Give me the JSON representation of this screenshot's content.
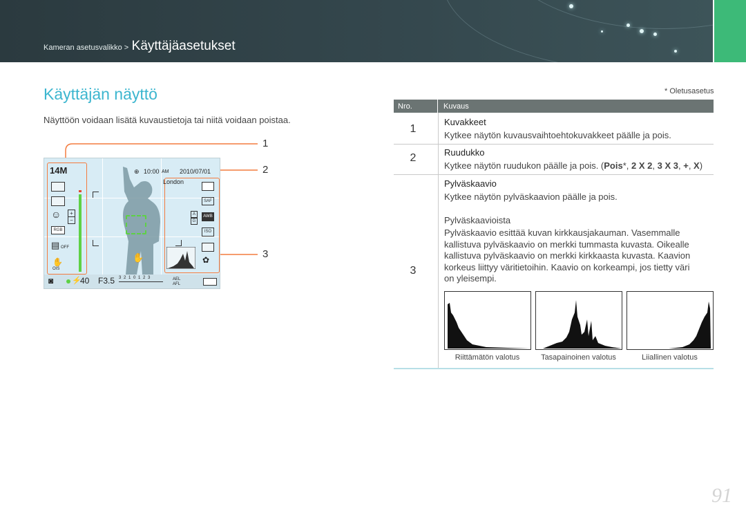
{
  "header": {
    "breadcrumb_parent": "Kameran asetusvalikko >",
    "breadcrumb_current": "Käyttäjäasetukset"
  },
  "page_title": "Käyttäjän näyttö",
  "intro": "Näyttöön voidaan lisätä kuvaustietoja tai niitä voidaan poistaa.",
  "callouts": [
    "1",
    "2",
    "3"
  ],
  "camera_display": {
    "resolution": "14M",
    "time": "10:00",
    "ampm": "AM",
    "date": "2010/07/01",
    "city": "London",
    "iso": "40",
    "aperture": "F3.5",
    "scale": "3 2 1 0 1 2 3",
    "ael": "AEL",
    "afl": "AFL",
    "ois": "OIS",
    "off": "OFF"
  },
  "default_note": "* Oletusasetus",
  "table": {
    "col_nro": "Nro.",
    "col_desc": "Kuvaus",
    "rows": [
      {
        "nro": "1",
        "title": "Kuvakkeet",
        "text": "Kytkee näytön kuvausvaihtoehtokuvakkeet päälle ja pois."
      },
      {
        "nro": "2",
        "title": "Ruudukko",
        "text_pre": "Kytkee näytön ruudukon päälle ja pois. (",
        "opt_pois": "Pois",
        "star": "*",
        "sep": ", ",
        "opt_2x2": "2 X 2",
        "opt_3x3": "3 X 3",
        "opt_plus": "+",
        "opt_x": "X",
        "close": ")"
      },
      {
        "nro": "3",
        "title": "Pylväskaavio",
        "text": "Kytkee näytön pylväskaavion päälle ja pois.",
        "subtitle": "Pylväskaavioista",
        "lines": [
          "Pylväskaavio esittää kuvan kirkkausjakauman. Vasemmalle",
          "kallistuva pylväskaavio on merkki tummasta kuvasta. Oikealle",
          "kallistuva pylväskaavio on merkki kirkkaasta kuvasta. Kaavion",
          "korkeus liittyy väritietoihin. Kaavio on korkeampi, jos tietty väri",
          "on yleisempi."
        ],
        "histograms": [
          "Riittämätön valotus",
          "Tasapainoinen valotus",
          "Liiallinen valotus"
        ]
      }
    ]
  },
  "page_number": "91",
  "colors": {
    "header": "#2f4045",
    "accent_green": "#3dba78",
    "title_blue": "#3cb6cf",
    "callout_orange": "#f47b3e",
    "table_head": "#6b7473"
  }
}
